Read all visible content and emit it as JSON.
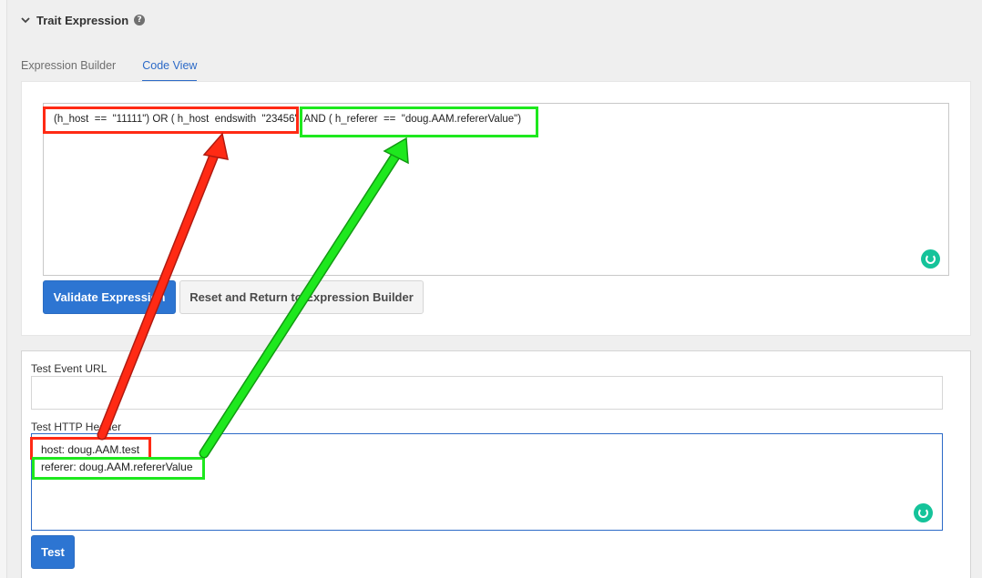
{
  "section": {
    "title": "Trait Expression",
    "help_glyph": "?"
  },
  "tabs": [
    {
      "label": "Expression Builder",
      "active": false
    },
    {
      "label": "Code View",
      "active": true
    }
  ],
  "code_view": {
    "expression": "(h_host  ==  \"11111\") OR ( h_host  endswith  \"23456\"  AND ( h_referer  ==  \"doug.AAM.refererValue\")",
    "validate_label": "Validate Expression",
    "reset_label": "Reset and Return to Expression Builder"
  },
  "test": {
    "url_label": "Test Event URL",
    "url_value": "",
    "header_label": "Test HTTP Header",
    "header_lines": [
      "host: doug.AAM.test",
      "referer: doug.AAM.refererValue"
    ],
    "test_label": "Test"
  },
  "colors": {
    "accent": "#2d75d2",
    "annotation_red": "#ff2a14",
    "annotation_green": "#1ee81e",
    "grammarly": "#15c39a"
  }
}
